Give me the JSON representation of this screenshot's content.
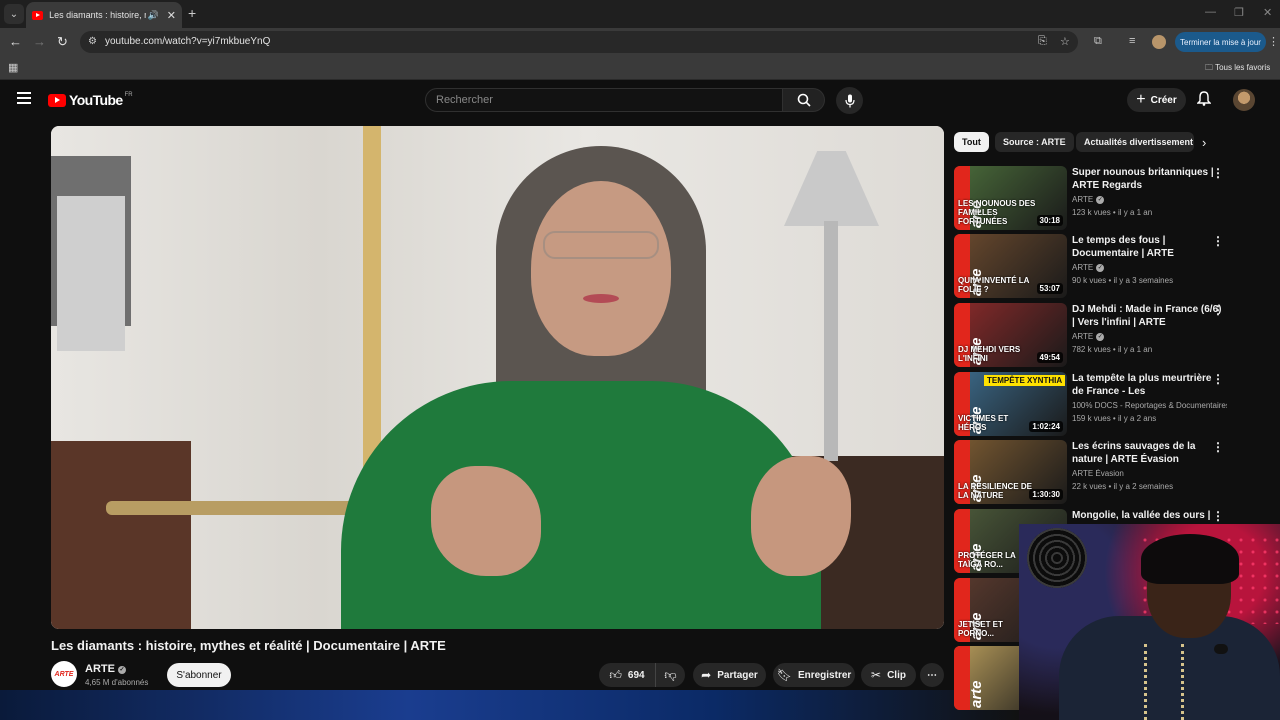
{
  "browser": {
    "tab": {
      "title": "Les diamants : histoire, mythes et réalité | Documentaire | ARTE"
    },
    "url": "youtube.com/watch?v=yi7mkbueYnQ",
    "update_label": "Terminer la mise à jour",
    "bookmarks_all": "Tous les favoris"
  },
  "youtube": {
    "logo_text": "YouTube",
    "country": "FR",
    "search_placeholder": "Rechercher",
    "create_label": "Créer"
  },
  "video": {
    "title": "Les diamants : histoire, mythes et réalité | Documentaire | ARTE",
    "channel": "ARTE",
    "subscribers": "4,65 M d'abonnés",
    "subscribe_label": "S'abonner",
    "likes": "694",
    "share_label": "Partager",
    "save_label": "Enregistrer",
    "clip_label": "Clip"
  },
  "chips": [
    "Tout",
    "Source : ARTE",
    "Actualités divertissement"
  ],
  "recommendations": [
    {
      "title": "Super nounous britanniques | ARTE Regards",
      "channel": "ARTE",
      "views": "123 k vues",
      "age": "il y a 1 an",
      "duration": "30:18",
      "caption": "LES NOUNOUS DES FAMILLES FORTUNÉES",
      "thumb_color": "#4a6b3a"
    },
    {
      "title": "Le temps des fous | Documentaire | ARTE",
      "channel": "ARTE",
      "views": "90 k vues",
      "age": "il y a 3 semaines",
      "duration": "53:07",
      "caption": "QUI A INVENTÉ LA FOLIE ?",
      "thumb_color": "#6b4a2e"
    },
    {
      "title": "DJ Mehdi : Made in France (6/6) | Vers l'infini | ARTE",
      "channel": "ARTE",
      "views": "782 k vues",
      "age": "il y a 1 an",
      "duration": "49:54",
      "caption": "DJ MEHDI VERS L'INFINI",
      "thumb_color": "#8a2a2a"
    },
    {
      "title": "La tempête la plus meurtrière de France - Les conséquences...",
      "channel": "100% DOCS - Reportages & Documentaires",
      "views": "159 k vues",
      "age": "il y a 2 ans",
      "duration": "1:02:24",
      "caption": "VICTIMES ET HÉROS",
      "tag": "TEMPÊTE XYNTHIA",
      "thumb_color": "#3c6a8a"
    },
    {
      "title": "Les écrins sauvages de la nature | ARTE Évasion",
      "channel": "ARTE Évasion",
      "views": "22 k vues",
      "age": "il y a 2 semaines",
      "duration": "1:30:30",
      "caption": "LA RÉSILIENCE DE LA NATURE",
      "thumb_color": "#7a5a32"
    },
    {
      "title": "Mongolie, la vallée des ours |",
      "channel": "",
      "views": "",
      "age": "",
      "duration": "",
      "caption": "PROTÉGER LA TAÏGA RO...",
      "thumb_color": "#4c5a3a"
    },
    {
      "title": "",
      "channel": "",
      "views": "",
      "age": "",
      "duration": "",
      "caption": "JET-SET ET PORNO...",
      "thumb_color": "#5a3a2e"
    },
    {
      "title": "",
      "channel": "",
      "views": "",
      "age": "",
      "duration": "",
      "caption": "",
      "thumb_color": "#b59a5a"
    }
  ]
}
